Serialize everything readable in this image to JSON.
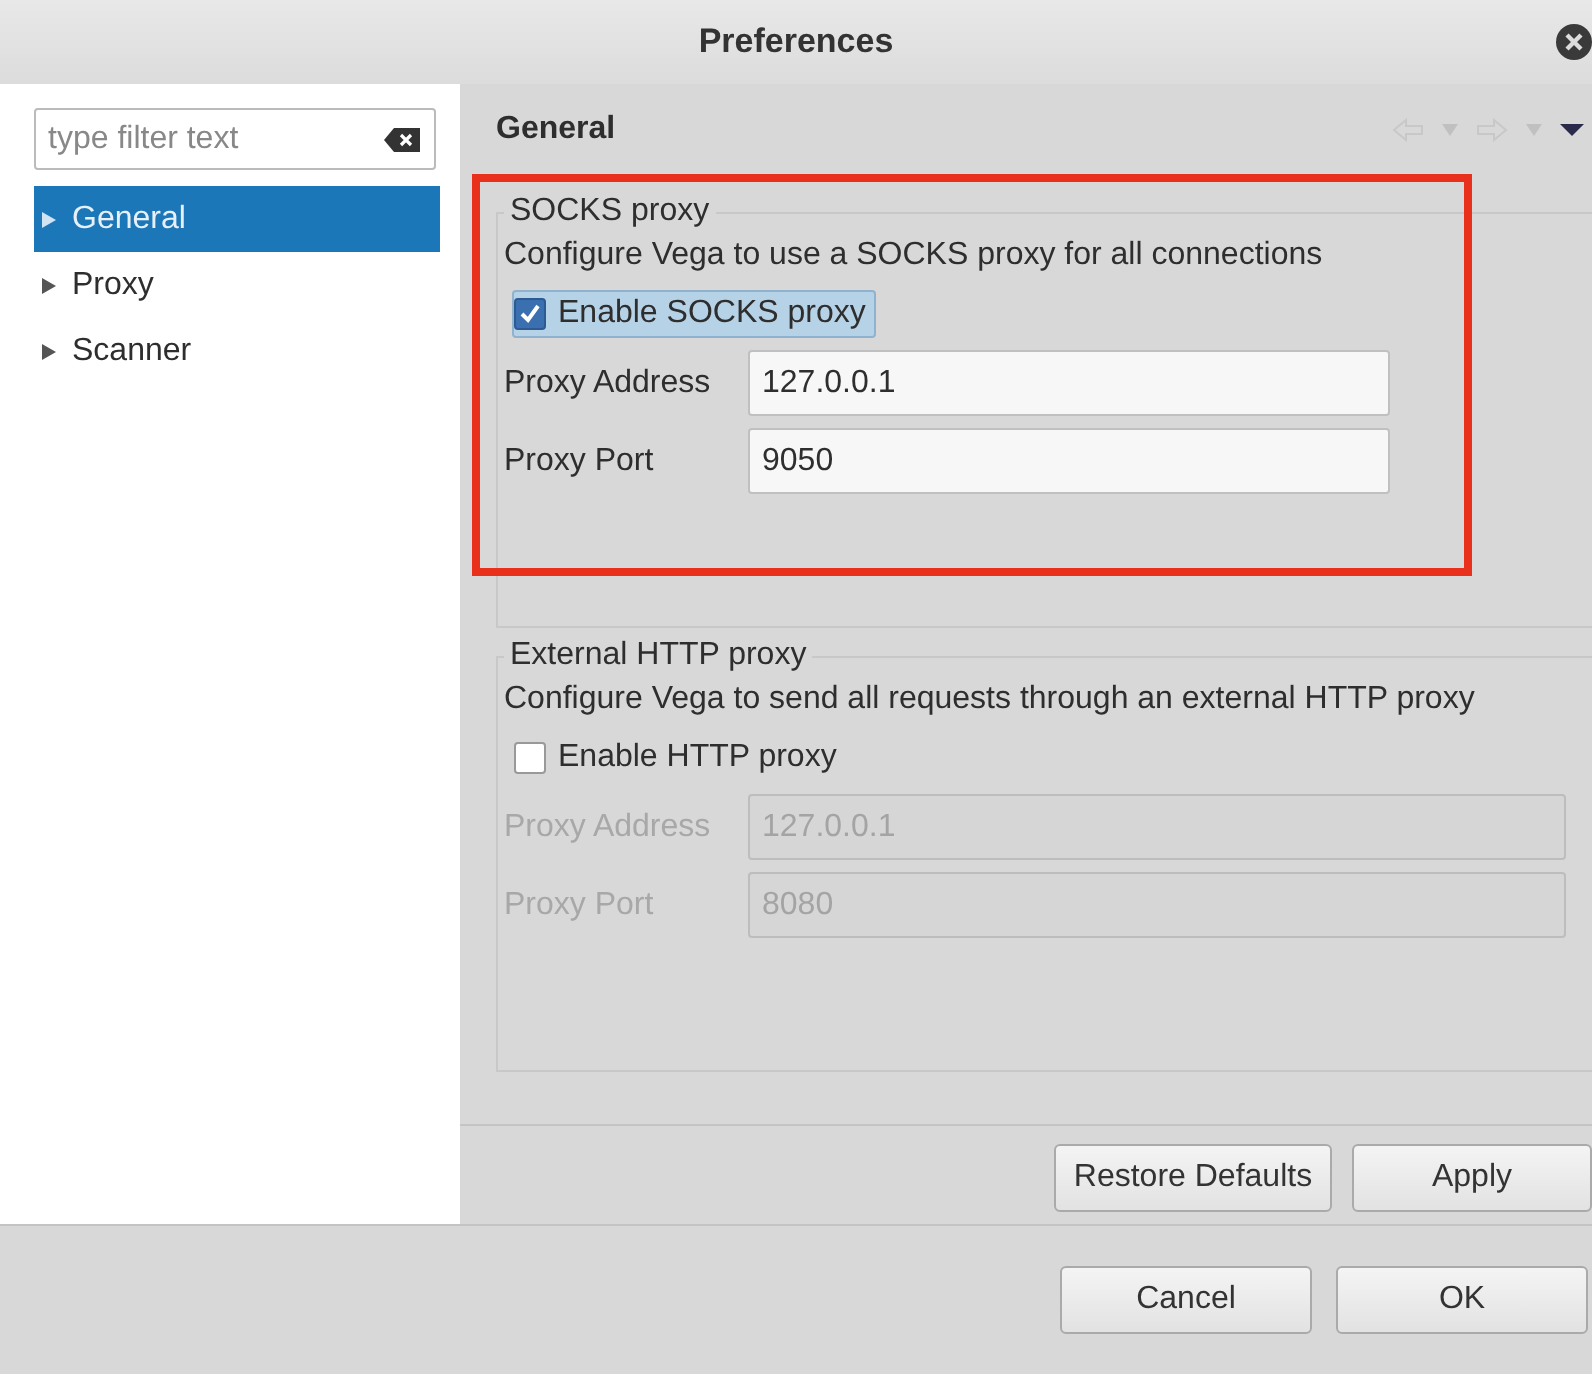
{
  "window": {
    "title": "Preferences"
  },
  "filter": {
    "placeholder": "type filter text"
  },
  "tree": [
    {
      "label": "General",
      "selected": true
    },
    {
      "label": "Proxy",
      "selected": false
    },
    {
      "label": "Scanner",
      "selected": false
    }
  ],
  "page": {
    "title": "General"
  },
  "groups": [
    {
      "title": "SOCKS proxy",
      "description": "Configure Vega to use a SOCKS proxy for all connections",
      "highlighted": true,
      "checkbox": {
        "label": "Enable SOCKS proxy",
        "checked": true,
        "focused": true
      },
      "fields": [
        {
          "label": "Proxy Address",
          "value": "127.0.0.1",
          "disabled": false
        },
        {
          "label": "Proxy Port",
          "value": "9050",
          "disabled": false
        }
      ]
    },
    {
      "title": "External HTTP proxy",
      "description": "Configure Vega to send all requests through an external HTTP proxy",
      "highlighted": false,
      "checkbox": {
        "label": "Enable HTTP proxy",
        "checked": false,
        "focused": false
      },
      "fields": [
        {
          "label": "Proxy Address",
          "value": "127.0.0.1",
          "disabled": true
        },
        {
          "label": "Proxy Port",
          "value": "8080",
          "disabled": true
        }
      ]
    }
  ],
  "page_buttons": [
    "Restore Defaults",
    "Apply"
  ],
  "dialog_buttons": [
    "Cancel",
    "OK"
  ]
}
